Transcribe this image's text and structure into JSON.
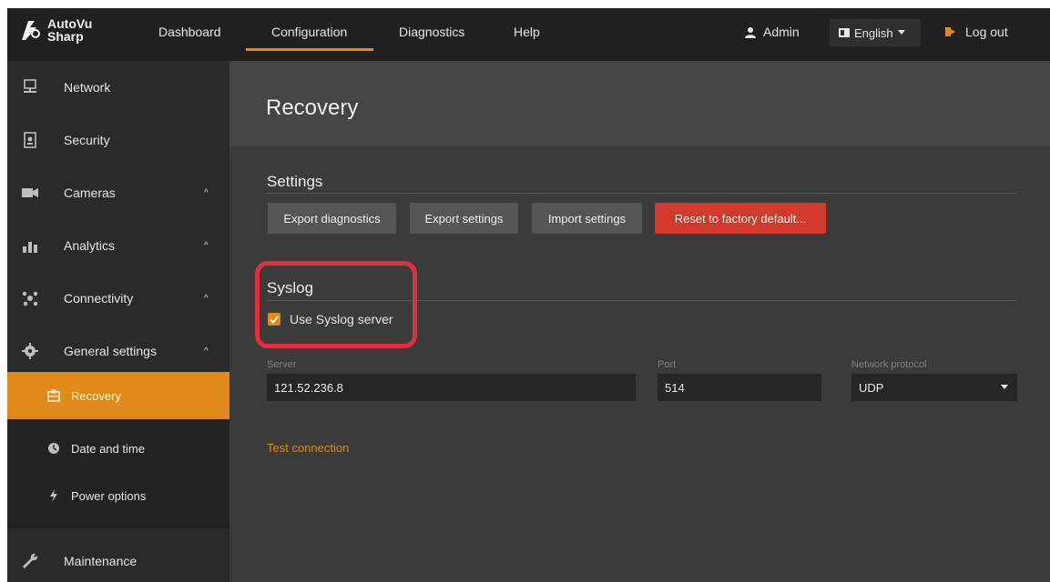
{
  "app": {
    "logo_line1": "AutoVu",
    "logo_line2": "Sharp",
    "accent": "#e08a1e",
    "danger": "#d23a2e"
  },
  "nav": {
    "items": [
      {
        "label": "Dashboard"
      },
      {
        "label": "Configuration",
        "active": true
      },
      {
        "label": "Diagnostics"
      },
      {
        "label": "Help"
      }
    ],
    "user": "Admin",
    "language": "English",
    "logout": "Log out"
  },
  "sidebar": {
    "items": [
      {
        "label": "Network",
        "icon": "network-icon"
      },
      {
        "label": "Security",
        "icon": "security-icon"
      },
      {
        "label": "Cameras",
        "icon": "camera-icon",
        "expanded": true
      },
      {
        "label": "Analytics",
        "icon": "analytics-icon",
        "expanded": true
      },
      {
        "label": "Connectivity",
        "icon": "connectivity-icon",
        "expanded": true
      },
      {
        "label": "General settings",
        "icon": "gear-icon",
        "expanded": true
      }
    ],
    "subitems": [
      {
        "label": "Recovery",
        "icon": "recovery-icon",
        "active": true
      },
      {
        "label": "Date and time",
        "icon": "clock-icon"
      },
      {
        "label": "Power options",
        "icon": "power-icon"
      }
    ],
    "footer_item": {
      "label": "Maintenance",
      "icon": "wrench-icon"
    },
    "chevron": "^"
  },
  "main": {
    "title": "Recovery",
    "settings": {
      "title": "Settings",
      "buttons": [
        "Export diagnostics",
        "Export settings",
        "Import settings",
        "Reset to factory default..."
      ]
    },
    "syslog": {
      "title": "Syslog",
      "use_syslog_label": "Use Syslog server",
      "use_syslog_checked": true,
      "server_label": "Server",
      "server_value": "121.52.236.8",
      "port_label": "Port",
      "port_value": "514",
      "protocol_label": "Network protocol",
      "protocol_value": "UDP",
      "test_link": "Test connection"
    }
  }
}
